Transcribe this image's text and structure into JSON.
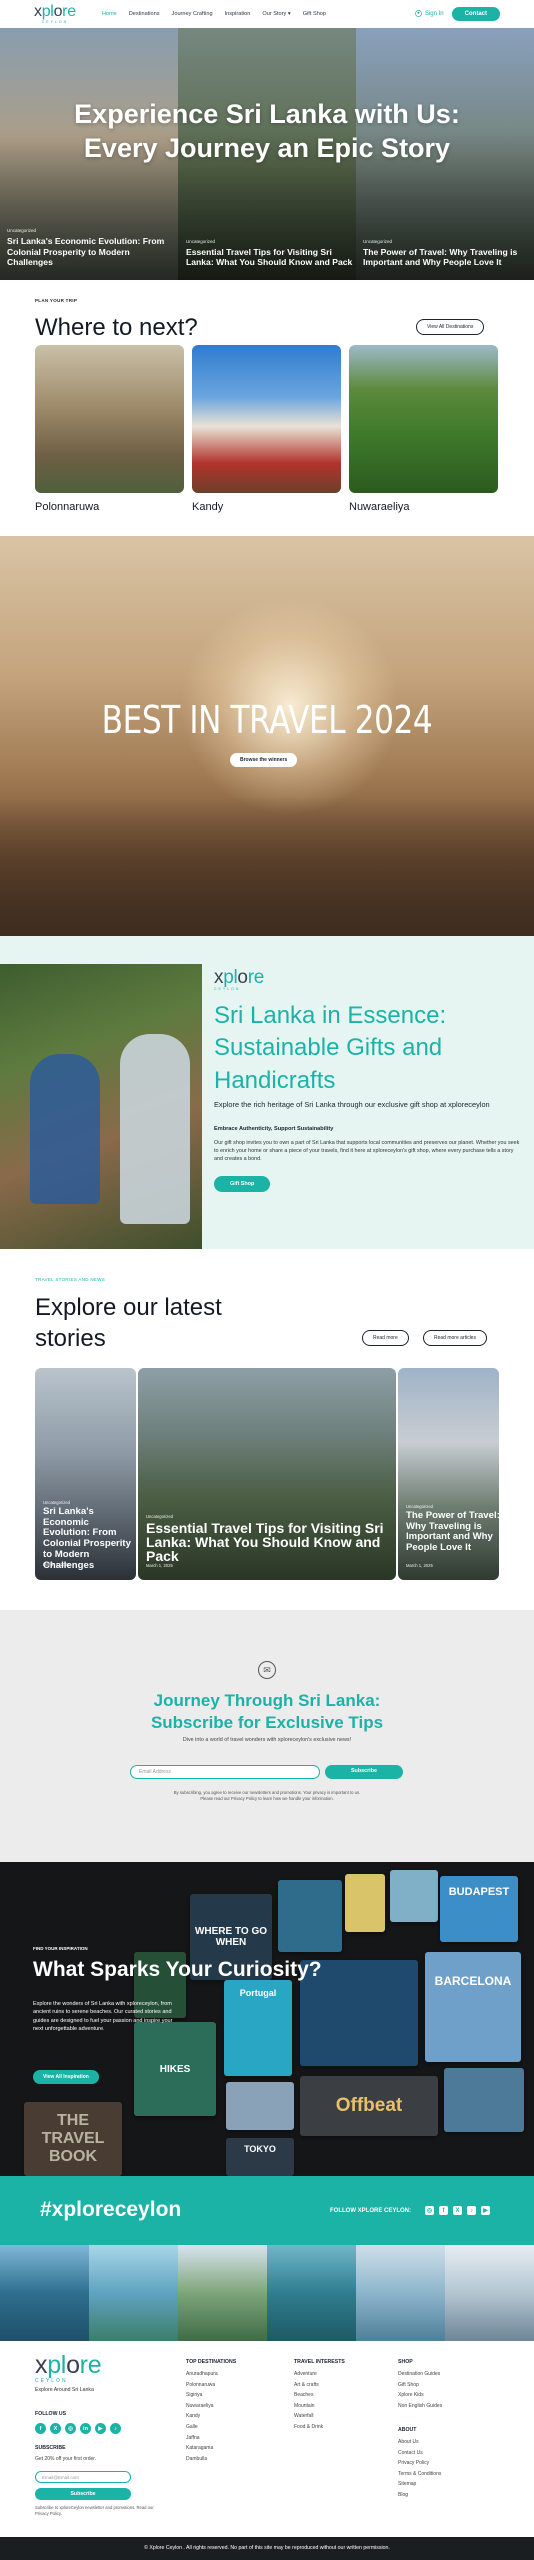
{
  "nav": {
    "logo_word_a": "x",
    "logo_word_b": "pl",
    "logo_word_c": "o",
    "logo_word_d": "re",
    "logo_sub": "CEYLON",
    "links": [
      "Home",
      "Destinations",
      "Journey Crafting",
      "Inspiration",
      "Our Story",
      "Gift Shop"
    ],
    "signin": "Sign In",
    "contact": "Contact"
  },
  "hero": {
    "title": "Experience Sri Lanka with Us: Every Journey an Epic Story",
    "cards": [
      {
        "category": "Uncategorized",
        "title": "Sri Lanka's Economic Evolution: From Colonial Prosperity to Modern Challenges"
      },
      {
        "category": "Uncategorized",
        "title": "Essential Travel Tips for Visiting Sri Lanka: What You Should Know and Pack"
      },
      {
        "category": "Uncategorized",
        "title": "The Power of Travel: Why Traveling is Important and Why People Love It"
      }
    ]
  },
  "destinations": {
    "kicker": "PLAN YOUR TRIP",
    "title": "Where to next?",
    "view_all": "View All Destinations",
    "items": [
      "Polonnaruwa",
      "Kandy",
      "Nuwaraeliya"
    ]
  },
  "best": {
    "title": "BEST IN TRAVEL 2024",
    "button": "Browse the winners"
  },
  "essence": {
    "title": "Sri Lanka in Essence: Sustainable Gifts and Handicrafts",
    "lead": "Explore the rich heritage of Sri Lanka through our exclusive gift shop at xploreceylon",
    "bold": "Embrace Authenticity, Support Sustainability",
    "body": "Our gift shop invites you to own a part of Sri Lanka that supports local communities and preserves our planet. Whether you seek to enrich your home or share a piece of your travels, find it here at xploreceylon's gift shop, where every purchase tells a story and creates a bond.",
    "button": "Gift Shop"
  },
  "stories": {
    "kicker": "TRAVEL STORIES AND NEWS",
    "title_line1": "Explore our latest",
    "title_line2": "stories",
    "read_more": "Read more",
    "read_more_articles": "Read more articles",
    "items": [
      {
        "category": "Uncategorized",
        "title": "Sri Lanka's Economic Evolution: From Colonial Prosperity to Modern Challenges",
        "date": "March 1, 2025"
      },
      {
        "category": "Uncategorized",
        "title": "Essential Travel Tips for Visiting Sri Lanka: What You Should Know and Pack",
        "date": "March 1, 2025"
      },
      {
        "category": "Uncategorized",
        "title": "The Power of Travel: Why Traveling is Important and Why People Love It",
        "date": "March 1, 2025"
      }
    ]
  },
  "subscribe": {
    "title_line1": "Journey Through Sri Lanka:",
    "title_line2": "Subscribe for Exclusive Tips",
    "sub": "Dive into a world of travel wonders with xploreceylon's exclusive news!",
    "placeholder": "Email Address",
    "button": "Subscribe",
    "legal_1": "By subscribing, you agree to receive our newsletters and promotions. Your privacy is important to us.",
    "legal_2": "Please read our Privacy Policy to learn how we handle your information."
  },
  "curiosity": {
    "kicker": "FIND YOUR INSPIRATION",
    "title": "What Sparks Your Curiosity?",
    "desc": "Explore the wonders of Sri Lanka with xploreceylon, from ancient ruins to serene beaches. Our curated stories and guides are designed to fuel your passion and inspire your next unforgettable adventure.",
    "button": "View All Inspiration",
    "books": [
      "WHERE TO GO WHEN",
      "Portugal",
      "BUDAPEST",
      "BARCELONA",
      "Offbeat",
      "HIKES",
      "TOKYO",
      "THE TRAVEL BOOK"
    ]
  },
  "hashtag": {
    "tag": "#xploreceylon",
    "follow": "FOLLOW XPLORE CEYLON:",
    "icons": [
      "instagram-icon",
      "facebook-icon",
      "x-icon",
      "tiktok-icon",
      "youtube-icon"
    ]
  },
  "footer": {
    "tagline": "Explore Around Sri Lanka",
    "follow_label": "FOLLOW US",
    "subscribe_label": "SUBSCRIBE",
    "subscribe_text": "Get 20% off your first order.",
    "email_placeholder": "Email@Email.com",
    "subscribe_button": "Subscribe",
    "legal": "Subscribe to xploreCeylon newsletter and promotions. Read our Privacy Policy.",
    "columns": [
      {
        "heading": "TOP DESTINATIONS",
        "items": [
          "Anuradhapura",
          "Polonnaruwa",
          "Sigiriya",
          "Nuwaraeliya",
          "Kandy",
          "Galle",
          "Jaffna",
          "Kataragama",
          "Dambulla"
        ]
      },
      {
        "heading": "TRAVEL INTERESTS",
        "items": [
          "Adventure",
          "Art & crafts",
          "Beaches",
          "Mountain",
          "Waterfall",
          "Food & Drink"
        ]
      },
      {
        "heading": "SHOP",
        "items": [
          "Destination Guides",
          "Gift Shop",
          "Xplore Kids",
          "Non English Guides"
        ]
      },
      {
        "heading": "ABOUT",
        "items": [
          "About Us",
          "Contact Us",
          "Privacy Policy",
          "Terms & Conditions",
          "Sitemap",
          "Blog"
        ]
      }
    ]
  },
  "bottombar": {
    "text": "© Xplore Ceylon . All rights reserved. No part of this site may be reproduced without our written permission."
  },
  "colors": {
    "accent": "#1bb3a6",
    "dark": "#1b2230",
    "essence_bg": "#e6f5f2",
    "subscribe_bg": "#ececed"
  }
}
